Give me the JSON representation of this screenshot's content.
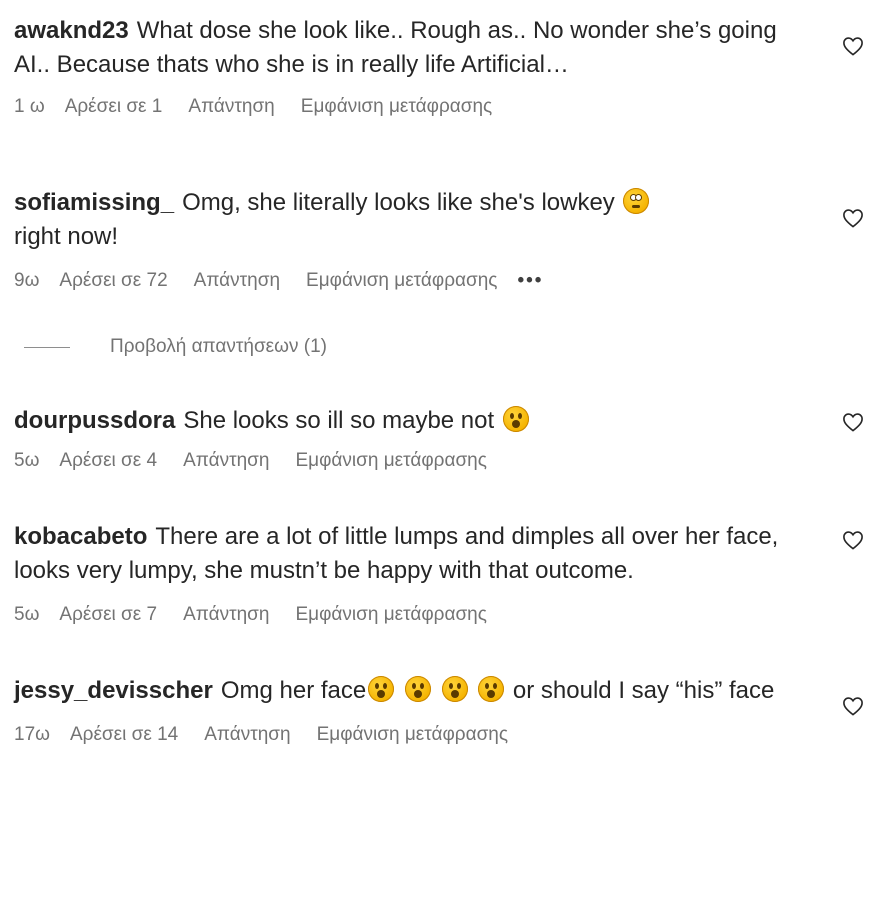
{
  "comments": [
    {
      "username": "awaknd23",
      "text": "What dose she look like.. Rough as.. No wonder she’s going AI.. Because thats who she is in really life Artificial…",
      "time": "1 ω",
      "likes": "Αρέσει σε 1",
      "reply": "Απάντηση",
      "translate": "Εμφάνιση μετάφρασης",
      "icon": "heart-icon"
    },
    {
      "username": "sofiamissing_",
      "text_before": "Omg, she literally looks like she's lowkey",
      "emoji": "flushed-face-emoji",
      "text_after": "right now!",
      "time": "9ω",
      "likes": "Αρέσει σε 72",
      "reply": "Απάντηση",
      "translate": "Εμφάνιση μετάφρασης",
      "more": "•••",
      "view_replies": "Προβολή απαντήσεων (1)",
      "icon": "heart-icon"
    },
    {
      "username": "dourpussdora",
      "text": "She looks so ill so maybe not",
      "emoji": "hushed-face-emoji",
      "time": "5ω",
      "likes": "Αρέσει σε 4",
      "reply": "Απάντηση",
      "translate": "Εμφάνιση μετάφρασης",
      "icon": "heart-icon"
    },
    {
      "username": "kobacabeto",
      "text": "There are a lot of little lumps and dimples all over her face, looks very lumpy, she mustn’t be happy with that outcome.",
      "time": "5ω",
      "likes": "Αρέσει σε 7",
      "reply": "Απάντηση",
      "translate": "Εμφάνιση μετάφρασης",
      "icon": "heart-icon"
    },
    {
      "username": "jessy_devisscher",
      "text_before": "Omg her face",
      "emoji": "hushed-face-emoji",
      "emoji_count": 4,
      "text_after": "or should I say “his” face",
      "time": "17ω",
      "likes": "Αρέσει σε 14",
      "reply": "Απάντηση",
      "translate": "Εμφάνιση μετάφρασης",
      "icon": "heart-icon"
    }
  ],
  "colors": {
    "text": "#262626",
    "meta": "#737373",
    "emoji": "#f5b300"
  }
}
